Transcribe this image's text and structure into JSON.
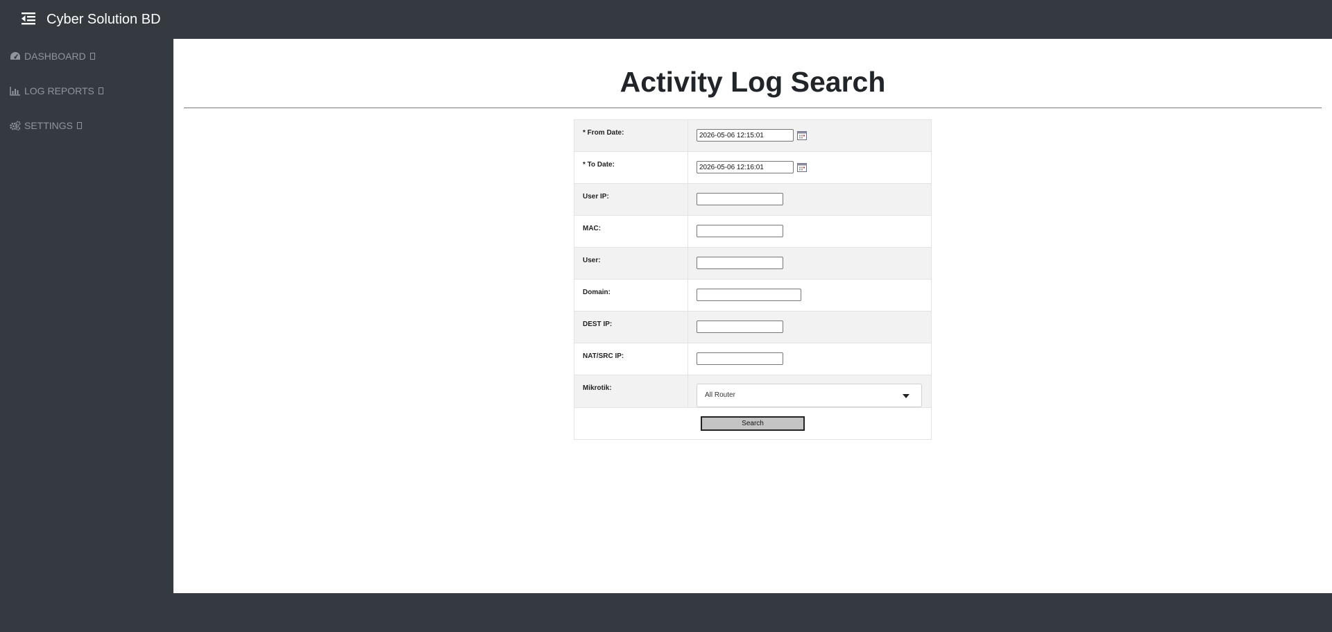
{
  "header": {
    "brand": "Cyber Solution BD",
    "toggle_icon": "menu-fold-icon"
  },
  "sidebar": {
    "items": [
      {
        "label": "DASHBOARD",
        "icon": "gauge-icon"
      },
      {
        "label": "LOG REPORTS",
        "icon": "bar-chart-icon"
      },
      {
        "label": "SETTINGS",
        "icon": "gears-icon"
      }
    ]
  },
  "main": {
    "title": "Activity Log Search",
    "form": {
      "from_date_label": "* From Date:",
      "from_date_value": "2026-05-06 12:15:01",
      "to_date_label": "* To Date:",
      "to_date_value": "2026-05-06 12:16:01",
      "user_ip_label": "User IP:",
      "mac_label": "MAC:",
      "user_label": "User:",
      "domain_label": "Domain:",
      "dest_ip_label": "DEST IP:",
      "nat_src_ip_label": "NAT/SRC IP:",
      "mikrotik_label": "Mikrotik:",
      "mikrotik_selected": "All Router",
      "search_label": "Search"
    }
  },
  "colors": {
    "chrome": "#343a40",
    "sidebar_text": "#8f969d",
    "content_bg": "#ffffff",
    "row_alt": "#f2f2f2",
    "button_bg": "#c4c4c4"
  }
}
